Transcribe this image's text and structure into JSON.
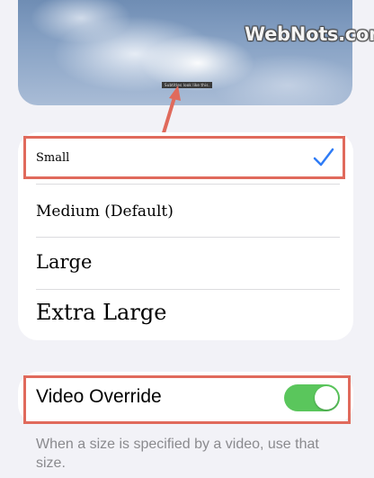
{
  "preview": {
    "caption_sample": "Subtitles look like this.",
    "watermark": "WebNots.com"
  },
  "caption_sizes": {
    "items": [
      {
        "label": "Small",
        "selected": true
      },
      {
        "label": "Medium (Default)",
        "selected": false
      },
      {
        "label": "Large",
        "selected": false
      },
      {
        "label": "Extra Large",
        "selected": false
      }
    ],
    "check_icon": "checkmark-icon"
  },
  "video_override": {
    "label": "Video Override",
    "enabled": true,
    "footnote": "When a size is specified by a video, use that size."
  },
  "colors": {
    "accent_check": "#2f7cf6",
    "toggle_on": "#5ac65c",
    "highlight": "#e06a5c"
  }
}
